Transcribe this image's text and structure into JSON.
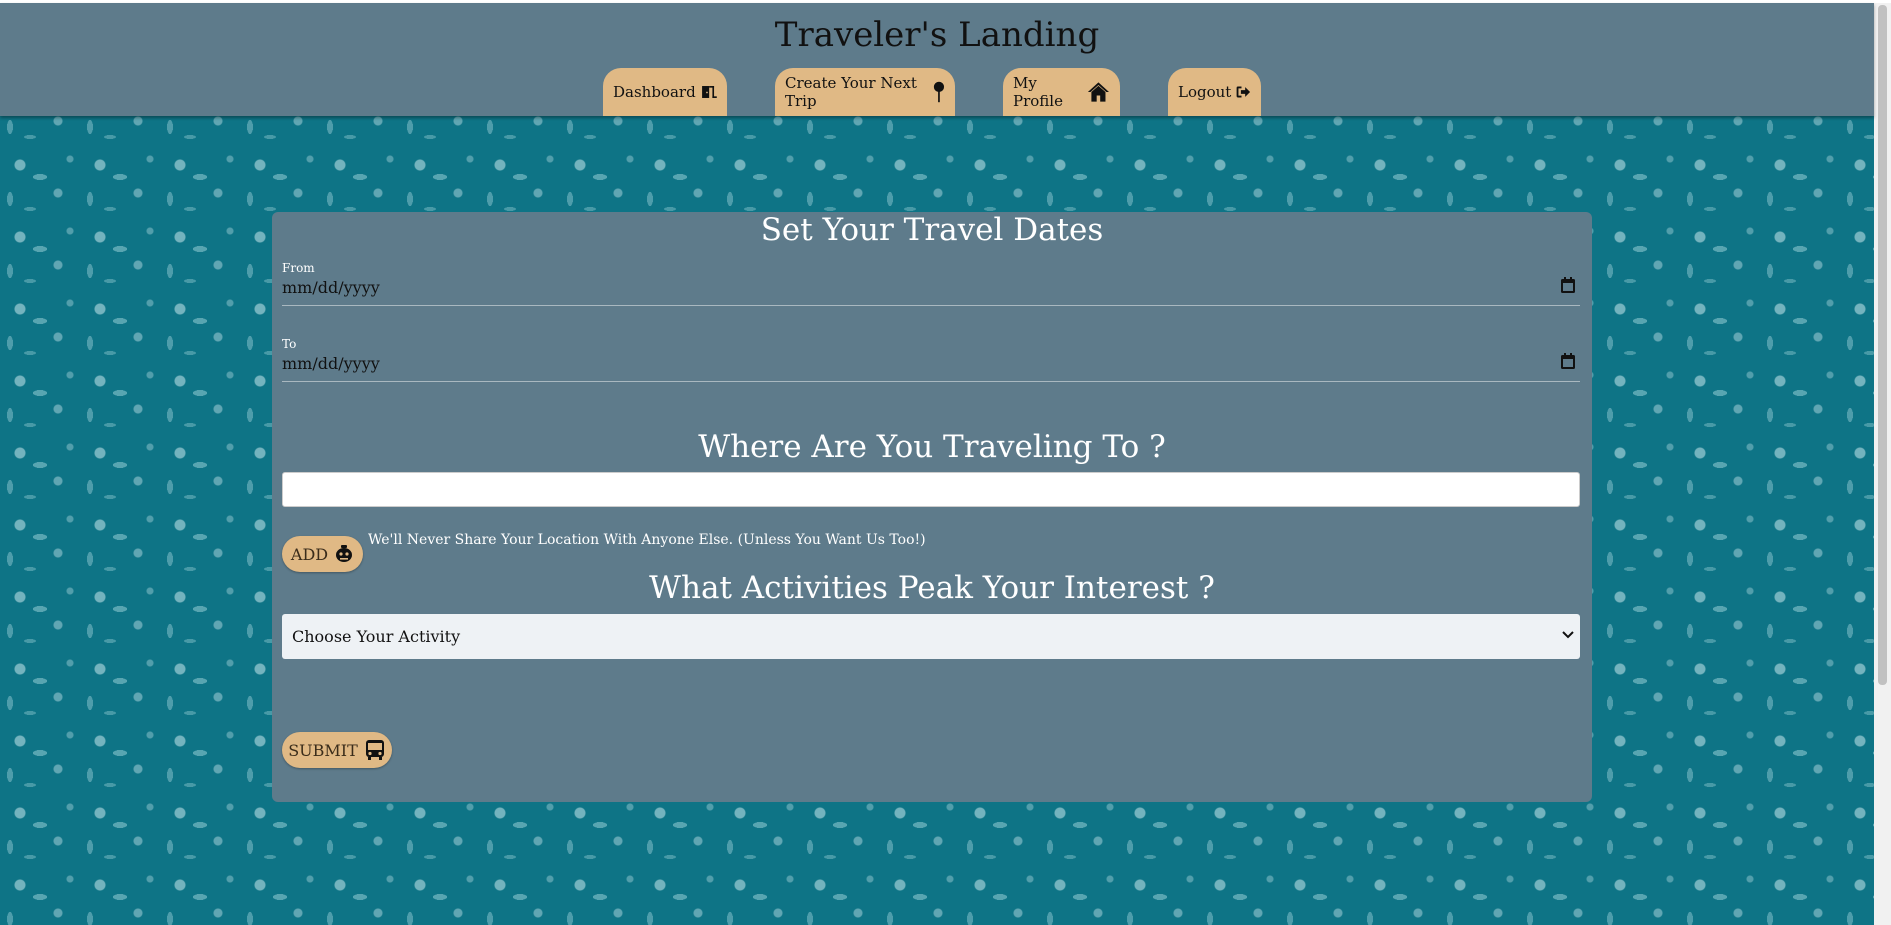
{
  "header": {
    "title": "Traveler's Landing",
    "nav": [
      {
        "label": "Dashboard",
        "icon": "door-exit-icon"
      },
      {
        "label": "Create Your Next Trip",
        "icon": "map-pin-icon"
      },
      {
        "label": "My Profile",
        "icon": "home-icon"
      },
      {
        "label": "Logout",
        "icon": "logout-icon"
      }
    ]
  },
  "dates": {
    "heading": "Set Your Travel Dates",
    "from_label": "From",
    "from_value": "mm/dd/yyyy",
    "to_label": "To",
    "to_value": "mm/dd/yyyy"
  },
  "destination": {
    "heading": "Where Are You Traveling To ?",
    "value": "",
    "add_label": "ADD",
    "note": "We'll Never Share Your Location With Anyone Else. (Unless You Want Us Too!)"
  },
  "activities": {
    "heading": "What Activities Peak Your Interest ?",
    "selected": "Choose Your Activity"
  },
  "submit": {
    "label": "SUBMIT",
    "icon": "bus-icon"
  },
  "colors": {
    "panel": "#5e7b8b",
    "accent": "#e0b985",
    "background": "#0e7486"
  }
}
